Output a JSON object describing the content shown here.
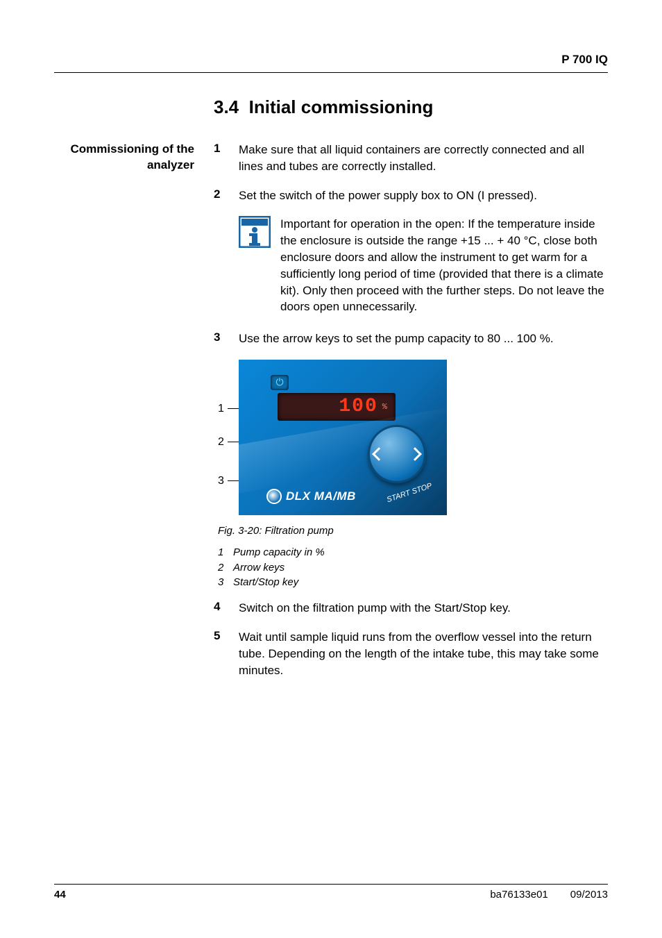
{
  "header": {
    "doc_id": "P 700 IQ"
  },
  "section": {
    "number": "3.4",
    "title": "Initial commissioning"
  },
  "sidebar": {
    "commissioning_label": "Commissioning of the analyzer"
  },
  "steps": {
    "s1": {
      "num": "1",
      "text": "Make sure that all liquid containers are correctly connected and all lines and tubes are correctly installed."
    },
    "s2": {
      "num": "2",
      "text": "Set the switch of the power supply box to ON (I pressed)."
    },
    "note": "Important for operation in the open: If the temperature inside the enclosure is outside the range +15 ... + 40 °C, close both enclosure doors and allow the instrument to get warm for a sufficiently long period of time (provided that there is a climate kit). Only then proceed with the further steps. Do not leave the doors open unnecessarily.",
    "s3": {
      "num": "3",
      "text": "Use the arrow keys to set the pump capacity to 80 ... 100 %."
    },
    "s4": {
      "num": "4",
      "text": "Switch on the filtration pump with the Start/Stop key."
    },
    "s5": {
      "num": "5",
      "text": "Wait until sample liquid runs from the overflow vessel into the return tube. Depending on the length of the intake tube, this may take some minutes."
    }
  },
  "figure": {
    "callouts": {
      "c1": "1",
      "c2": "2",
      "c3": "3"
    },
    "readout": "100",
    "readout_unit": "%",
    "brand": "DLX MA/MB",
    "startstop": "START\nSTOP",
    "caption": "Fig. 3-20: Filtration pump",
    "legend": {
      "l1": {
        "n": "1",
        "t": "Pump capacity in %"
      },
      "l2": {
        "n": "2",
        "t": "Arrow keys"
      },
      "l3": {
        "n": "3",
        "t": "Start/Stop key"
      }
    }
  },
  "footer": {
    "page": "44",
    "doc_code": "ba76133e01",
    "date": "09/2013"
  }
}
